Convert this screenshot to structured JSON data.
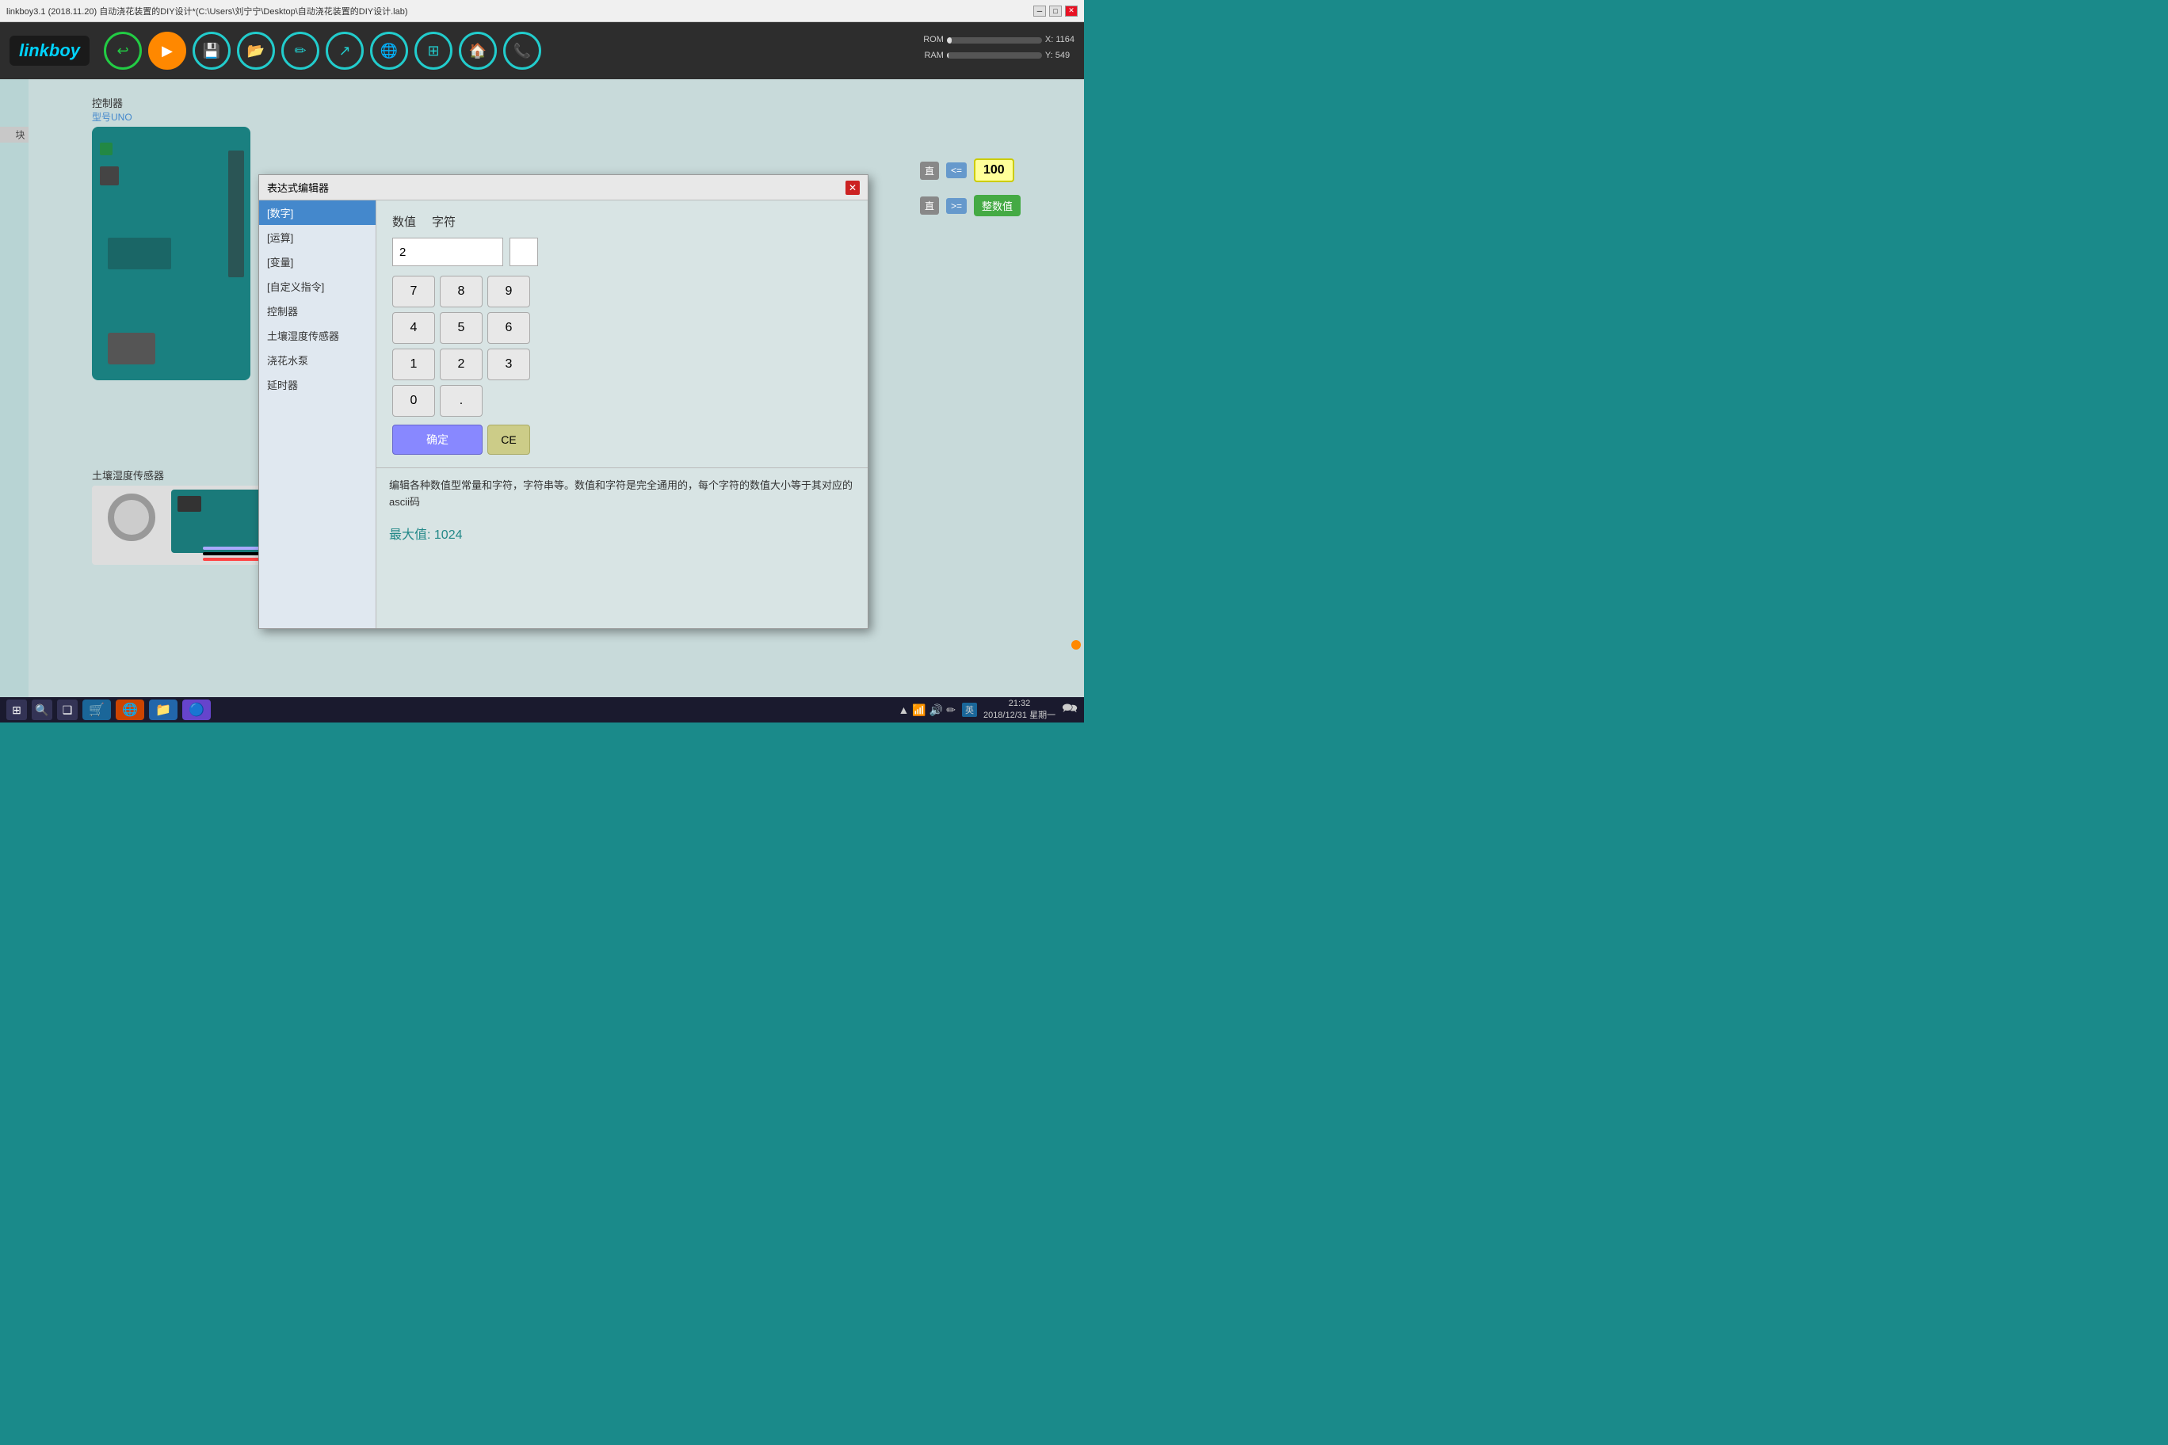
{
  "titlebar": {
    "title": "linkboy3.1 (2018.11.20) 自动浇花装置的DIY设计*(C:\\Users\\刘宁宁\\Desktop\\自动浇花装置的DIY设计.lab)",
    "min": "─",
    "max": "□",
    "close": "✕"
  },
  "toolbar": {
    "logo": "linkboy",
    "rom_label": "ROM",
    "ram_label": "RAM",
    "coords": "X: 1164\nY: 549",
    "rom_progress": 5,
    "ram_progress": 2
  },
  "sidebar": {
    "label": "块"
  },
  "controller": {
    "title": "控制器",
    "subtitle": "型号UNO"
  },
  "soil_sensor": {
    "title": "土壤湿度传感器"
  },
  "dialog": {
    "title": "表达式编辑器",
    "close": "✕",
    "categories": [
      {
        "label": "[数字]",
        "active": true
      },
      {
        "label": "[运算]",
        "active": false
      },
      {
        "label": "[变量]",
        "active": false
      },
      {
        "label": "[自定义指令]",
        "active": false
      },
      {
        "label": "控制器",
        "active": false
      },
      {
        "label": "土壤湿度传感器",
        "active": false
      },
      {
        "label": "浇花水泵",
        "active": false
      },
      {
        "label": "延时器",
        "active": false
      }
    ],
    "numpad": {
      "header_num": "数值",
      "header_char": "字符",
      "current_value": "2",
      "char_value": "",
      "buttons": [
        "7",
        "8",
        "9",
        "4",
        "5",
        "6",
        "1",
        "2",
        "3"
      ],
      "btn_0": "0",
      "btn_dot": ".",
      "btn_confirm": "确定",
      "btn_ce": "CE"
    },
    "description": "编辑各种数值型常量和字符，字符串等。数值和字符是完全通用的，每个字符的数值大小等于其对应的ascii码",
    "max_value": "最大值: 1024"
  },
  "right_blocks": {
    "operator_lte": "<=",
    "value_100": "100",
    "operator_gte": ">=",
    "integer_label": "整数值"
  },
  "taskbar": {
    "time": "21:32",
    "date": "2018/12/31 星期一",
    "lang": "英",
    "win_btn": "⊞",
    "search_btn": "⊕",
    "task_btn": "❑",
    "app1": "🗂",
    "app2": "🛒",
    "app3": "🌐",
    "app4": "📁",
    "app5": "🔵"
  }
}
